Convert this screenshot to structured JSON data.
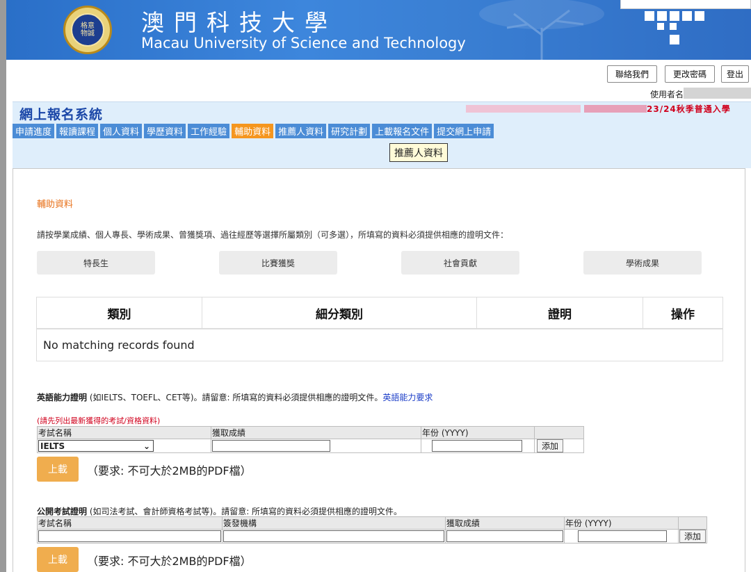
{
  "header": {
    "title_cn": "澳門科技大學",
    "title_en": "Macau University of Science and Technology",
    "logo_text": "格意\n物誠"
  },
  "topbar": {
    "contact_label": "聯絡我們",
    "change_password_label": "更改密碼",
    "logout_label": "登出",
    "username_label": "使用者名"
  },
  "system": {
    "title": "網上報名系統",
    "semester": "23/24秋季普通入學",
    "tabs": [
      {
        "label": "申請進度"
      },
      {
        "label": "報讀課程"
      },
      {
        "label": "個人資料"
      },
      {
        "label": "學歷資料"
      },
      {
        "label": "工作經驗"
      },
      {
        "label": "輔助資料",
        "active": true
      },
      {
        "label": "推薦人資料"
      },
      {
        "label": "研究計劃"
      },
      {
        "label": "上載報名文件"
      },
      {
        "label": "提交網上申請"
      }
    ],
    "tooltip": "推薦人資料"
  },
  "main": {
    "section_title": "輔助資料",
    "instruction": "請按學業成績、個人專長、學術成果、曾獲獎項、過往經歷等選擇所屬類別（可多選），所填寫的資料必須提供相應的證明文件：",
    "categories": [
      "特長生",
      "比賽獲獎",
      "社會貢獻",
      "學術成果"
    ],
    "table": {
      "columns": [
        "類別",
        "細分類別",
        "證明",
        "操作"
      ],
      "empty_text": "No matching records found"
    },
    "english": {
      "title": "英語能力證明",
      "desc": " (如IELTS、TOEFL、CET等)。請留意: 所填寫的資料必須提供相應的證明文件。",
      "link": "英語能力要求",
      "note": "(請先列出最新獲得的考試/資格資料)",
      "columns": [
        "考試名稱",
        "獲取成績",
        "年份 (YYYY)"
      ],
      "selected_exam": "IELTS",
      "add_label": "添加",
      "upload_label": "上載",
      "upload_note": "（要求: 不可大於2MB的PDF檔）"
    },
    "public_exam": {
      "title": "公開考試證明",
      "desc": " (如司法考試、會計師資格考試等)。請留意: 所填寫的資料必須提供相應的證明文件。",
      "columns": [
        "考試名稱",
        "簽發機構",
        "獲取成績",
        "年份 (YYYY)"
      ],
      "add_label": "添加",
      "upload_label": "上載",
      "upload_note": "（要求: 不可大於2MB的PDF檔）"
    }
  }
}
